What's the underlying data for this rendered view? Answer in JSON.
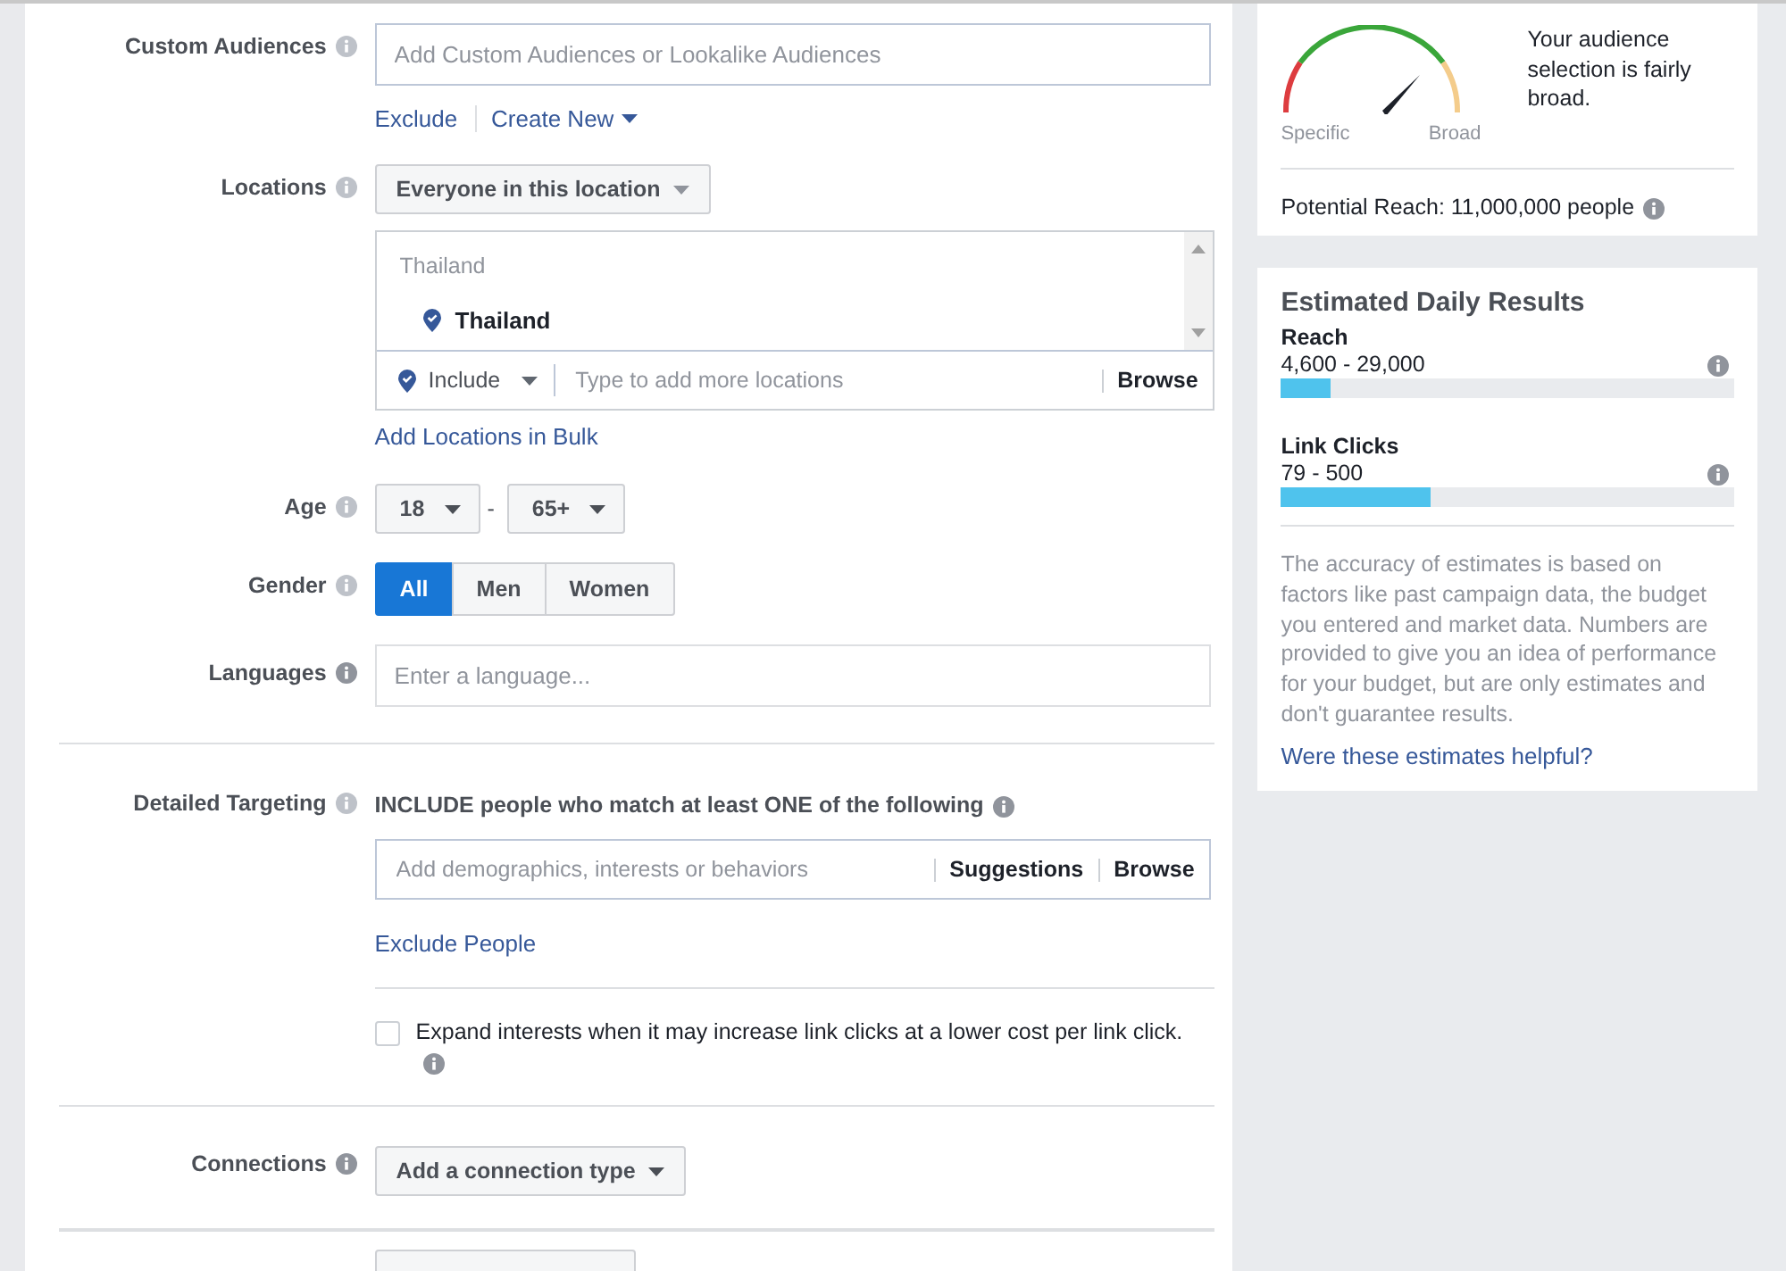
{
  "custom_audiences": {
    "label": "Custom Audiences",
    "placeholder": "Add Custom Audiences or Lookalike Audiences",
    "links": [
      {
        "label": "Exclude",
        "dropdown": false
      },
      {
        "label": "Create New",
        "dropdown": true
      }
    ]
  },
  "locations": {
    "label": "Locations",
    "mode": "Everyone in this location",
    "list_heading": "Thailand",
    "items": [
      {
        "name": "Thailand"
      }
    ],
    "include": "Include",
    "placeholder": "Type to add more locations",
    "browse": "Browse",
    "bulk_link": "Add Locations in Bulk"
  },
  "age": {
    "label": "Age",
    "min": "18",
    "separator": "-",
    "max": "65+"
  },
  "gender": {
    "label": "Gender",
    "options": [
      {
        "label": "All",
        "selected": true
      },
      {
        "label": "Men",
        "selected": false
      },
      {
        "label": "Women",
        "selected": false
      }
    ]
  },
  "languages": {
    "label": "Languages",
    "placeholder": "Enter a language..."
  },
  "detailed_targeting": {
    "label": "Detailed Targeting",
    "include_text": "INCLUDE people who match at least ONE of the following",
    "placeholder": "Add demographics, interests or behaviors",
    "suggestions": "Suggestions",
    "browse": "Browse",
    "exclude_link": "Exclude People",
    "expand": {
      "label": "Expand interests when it may increase link clicks at a lower cost per link click.",
      "checked": false
    }
  },
  "connections": {
    "label": "Connections",
    "button": "Add a connection type"
  },
  "audience_meter": {
    "specific_label": "Specific",
    "broad_label": "Broad",
    "message": "Your audience selection is fairly broad.",
    "potential_reach": "Potential Reach: 11,000,000 people"
  },
  "estimated_daily_results": {
    "title": "Estimated Daily Results",
    "metrics": [
      {
        "name": "Reach",
        "range": "4,600 - 29,000",
        "level": 0.11
      },
      {
        "name": "Link Clicks",
        "range": "79 - 500",
        "level": 0.33
      }
    ],
    "disclaimer": "The accuracy of estimates is based on factors like past campaign data, the budget you entered and market data. Numbers are provided to give you an idea of performance for your budget, but are only estimates and don't guarantee results.",
    "feedback_link": "Were these estimates helpful?"
  }
}
